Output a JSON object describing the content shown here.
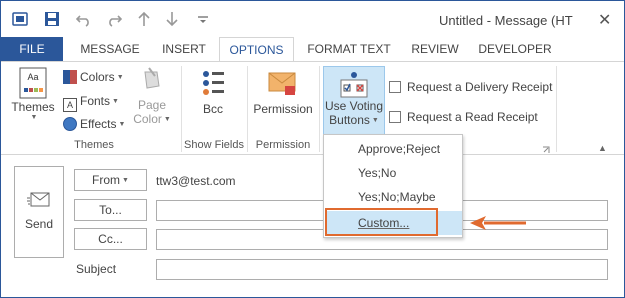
{
  "window": {
    "title": "Untitled - Message (HT",
    "close_glyph": "✕"
  },
  "qat": {
    "icons": [
      "outlook-icon",
      "save-icon",
      "undo-icon",
      "redo-icon",
      "up-arrow-icon",
      "down-arrow-icon",
      "customize-qat-icon"
    ]
  },
  "tabs": [
    {
      "label": "FILE"
    },
    {
      "label": "MESSAGE"
    },
    {
      "label": "INSERT"
    },
    {
      "label": "OPTIONS"
    },
    {
      "label": "FORMAT TEXT"
    },
    {
      "label": "REVIEW"
    },
    {
      "label": "DEVELOPER"
    }
  ],
  "ribbon": {
    "themes_group": {
      "themes_label": "Themes",
      "colors_label": "Colors",
      "fonts_label": "Fonts",
      "effects_label": "Effects",
      "page_label": "Page",
      "color_label": "Color",
      "group_label": "Themes"
    },
    "show_fields_group": {
      "bcc_label": "Bcc",
      "group_label": "Show Fields"
    },
    "permission_group": {
      "permission_label": "Permission",
      "group_label": "Permission"
    },
    "tracking_group": {
      "voting_label_line1": "Use Voting",
      "voting_label_line2": "Buttons",
      "delivery_receipt_label": "Request a Delivery Receipt",
      "read_receipt_label": "Request a Read Receipt"
    }
  },
  "colors": {
    "accent": "#2b579a",
    "menu_highlight": "#cde6f7",
    "callout": "#e06a2f"
  },
  "form": {
    "send_label": "Send",
    "from_label": "From",
    "from_address": "ttw3@test.com",
    "to_label": "To...",
    "cc_label": "Cc...",
    "subject_label": "Subject",
    "to_value": "",
    "cc_value": "",
    "subject_value": ""
  },
  "voting_menu": {
    "items": [
      {
        "label": "Approve;Reject"
      },
      {
        "label": "Yes;No"
      },
      {
        "label": "Yes;No;Maybe"
      },
      {
        "label": "Custom..."
      }
    ],
    "highlighted": "Custom..."
  }
}
